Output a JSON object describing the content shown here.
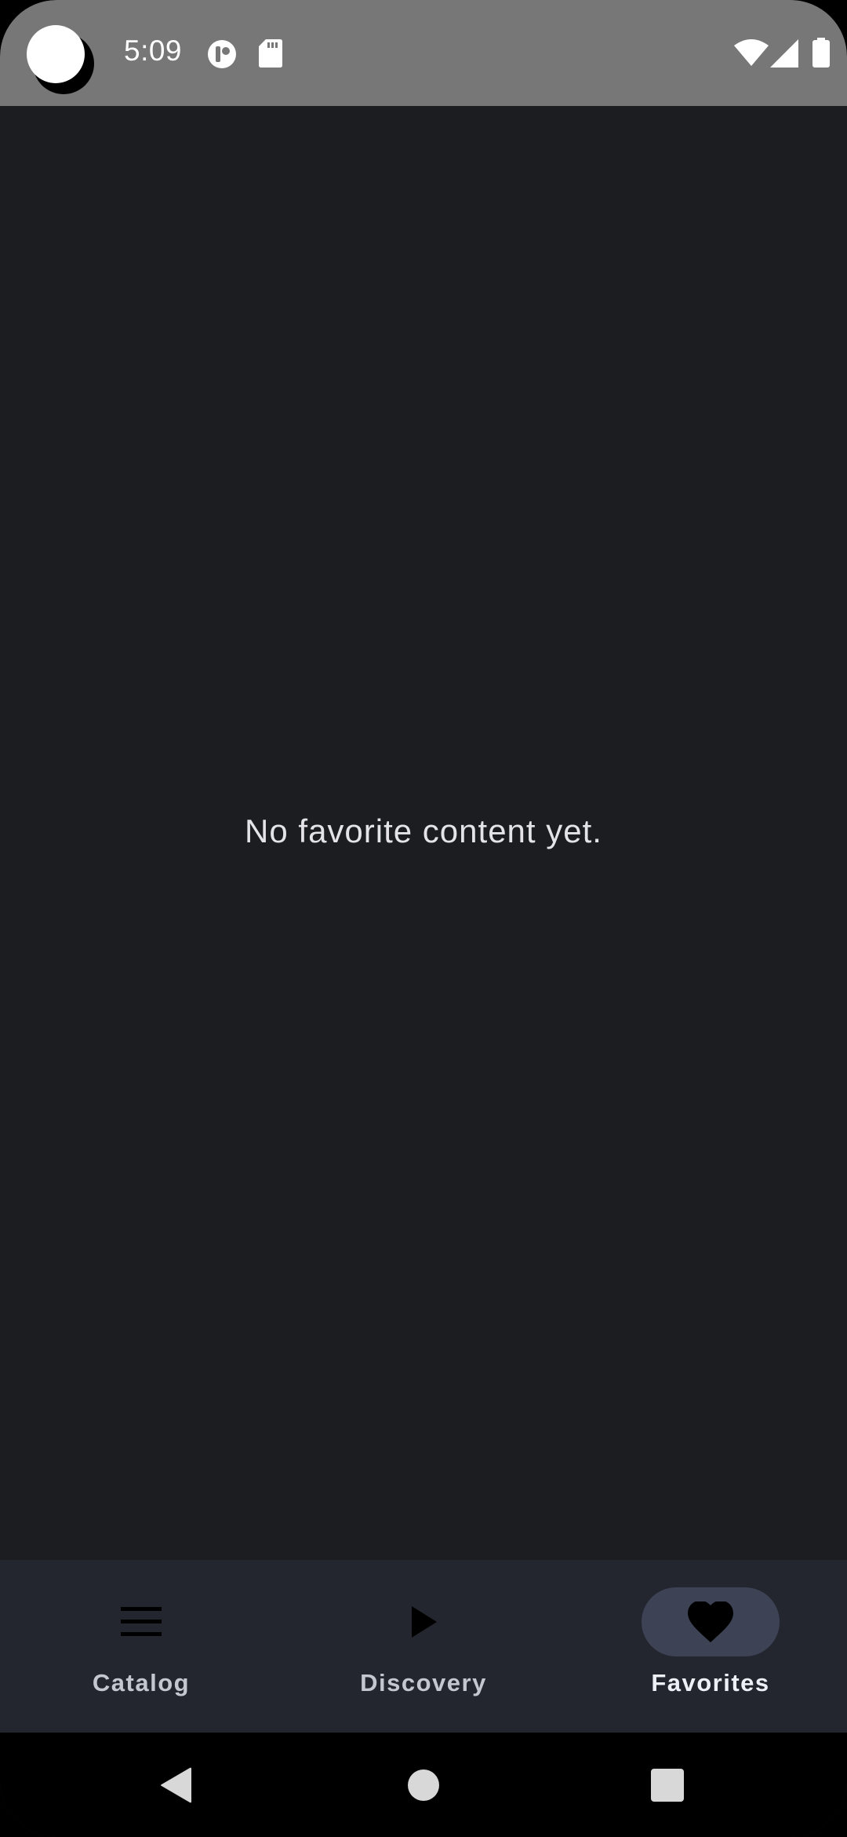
{
  "status_bar": {
    "time": "5:09",
    "icons": [
      "camera-cutout",
      "t-app-icon",
      "sd-card-icon",
      "wifi-icon",
      "cell-signal-icon",
      "battery-icon"
    ]
  },
  "main": {
    "empty_message": "No favorite content yet."
  },
  "bottom_nav": {
    "items": [
      {
        "label": "Catalog",
        "icon": "menu-icon",
        "active": false
      },
      {
        "label": "Discovery",
        "icon": "play-icon",
        "active": false
      },
      {
        "label": "Favorites",
        "icon": "heart-icon",
        "active": true
      }
    ]
  },
  "system_nav": {
    "buttons": [
      "back-icon",
      "home-icon",
      "recents-icon"
    ]
  },
  "colors": {
    "background": "#1c1d21",
    "status_bar": "#777777",
    "bottom_nav": "#24262f",
    "active_pill": "#3d4355",
    "text": "#e4e4e8"
  }
}
